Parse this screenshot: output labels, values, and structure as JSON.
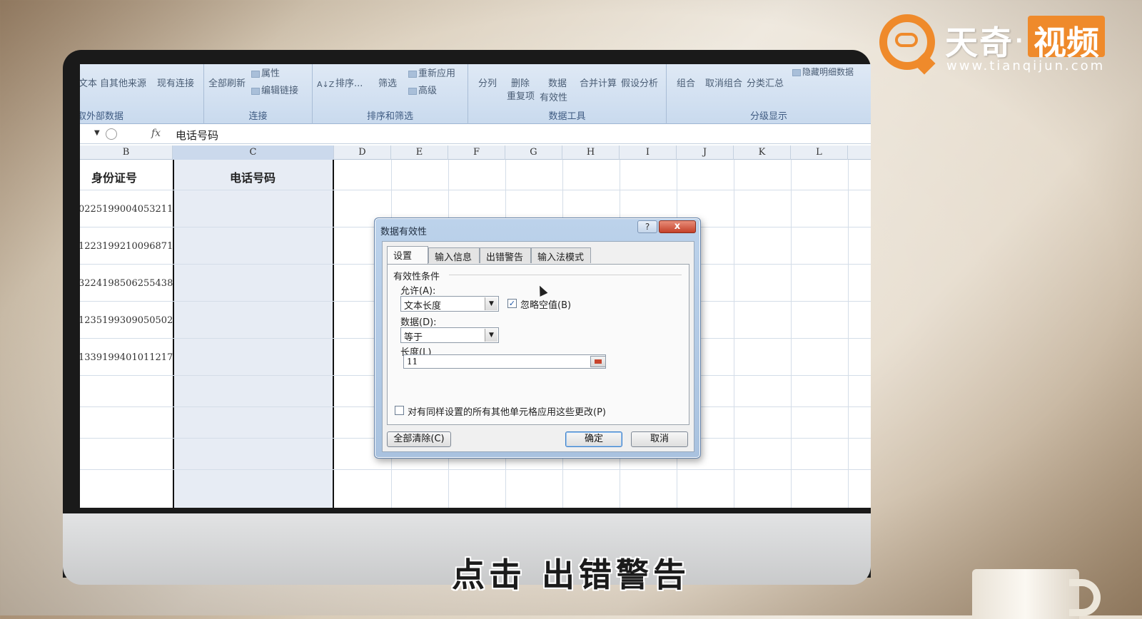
{
  "ribbon": {
    "groups": [
      {
        "label": "取外部数据",
        "buttons": [
          "文本",
          "自其他来源",
          "现有连接"
        ]
      },
      {
        "label": "连接",
        "buttons": [
          "全部刷新",
          "属性",
          "编辑链接"
        ]
      },
      {
        "label": "排序和筛选",
        "buttons": [
          "排序...",
          "筛选",
          "重新应用",
          "高级"
        ]
      },
      {
        "label": "数据工具",
        "buttons": [
          "分列",
          "删除",
          "重复项",
          "数据",
          "有效性",
          "合并计算",
          "假设分析"
        ]
      },
      {
        "label": "分级显示",
        "buttons": [
          "组合",
          "取消组合",
          "分类汇总",
          "隐藏明细数据"
        ]
      }
    ]
  },
  "formula_bar": {
    "fx": "fx",
    "content": "电话号码"
  },
  "columns": [
    "B",
    "C",
    "D",
    "E",
    "F",
    "G",
    "H",
    "I",
    "J",
    "K",
    "L"
  ],
  "sheet": {
    "headers": {
      "B": "身份证号",
      "C": "电话号码"
    },
    "id_numbers": [
      "0225199004053211",
      "1223199210096871",
      "3224198506255438",
      "1235199309050502",
      "1339199401011217"
    ]
  },
  "dialog": {
    "title": "数据有效性",
    "help": "?",
    "close": "x",
    "tabs": [
      "设置",
      "输入信息",
      "出错警告",
      "输入法模式"
    ],
    "section": "有效性条件",
    "allow_label": "允许(A):",
    "allow_value": "文本长度",
    "ignore_blank": "忽略空值(B)",
    "data_label": "数据(D):",
    "data_value": "等于",
    "length_label": "长度(L)",
    "length_value": "11",
    "apply_all": "对有同样设置的所有其他单元格应用这些更改(P)",
    "clear_all": "全部清除(C)",
    "ok": "确定",
    "cancel": "取消"
  },
  "watermark": {
    "brand1": "天奇",
    "dot": "·",
    "brand2": "视频",
    "url": "www.tianqijun.com"
  },
  "subtitle": "点击 出错警告",
  "colors": {
    "accent": "#ef8a2b",
    "ribbon": "#c9daee",
    "dialog_frame": "#a9c2df"
  }
}
